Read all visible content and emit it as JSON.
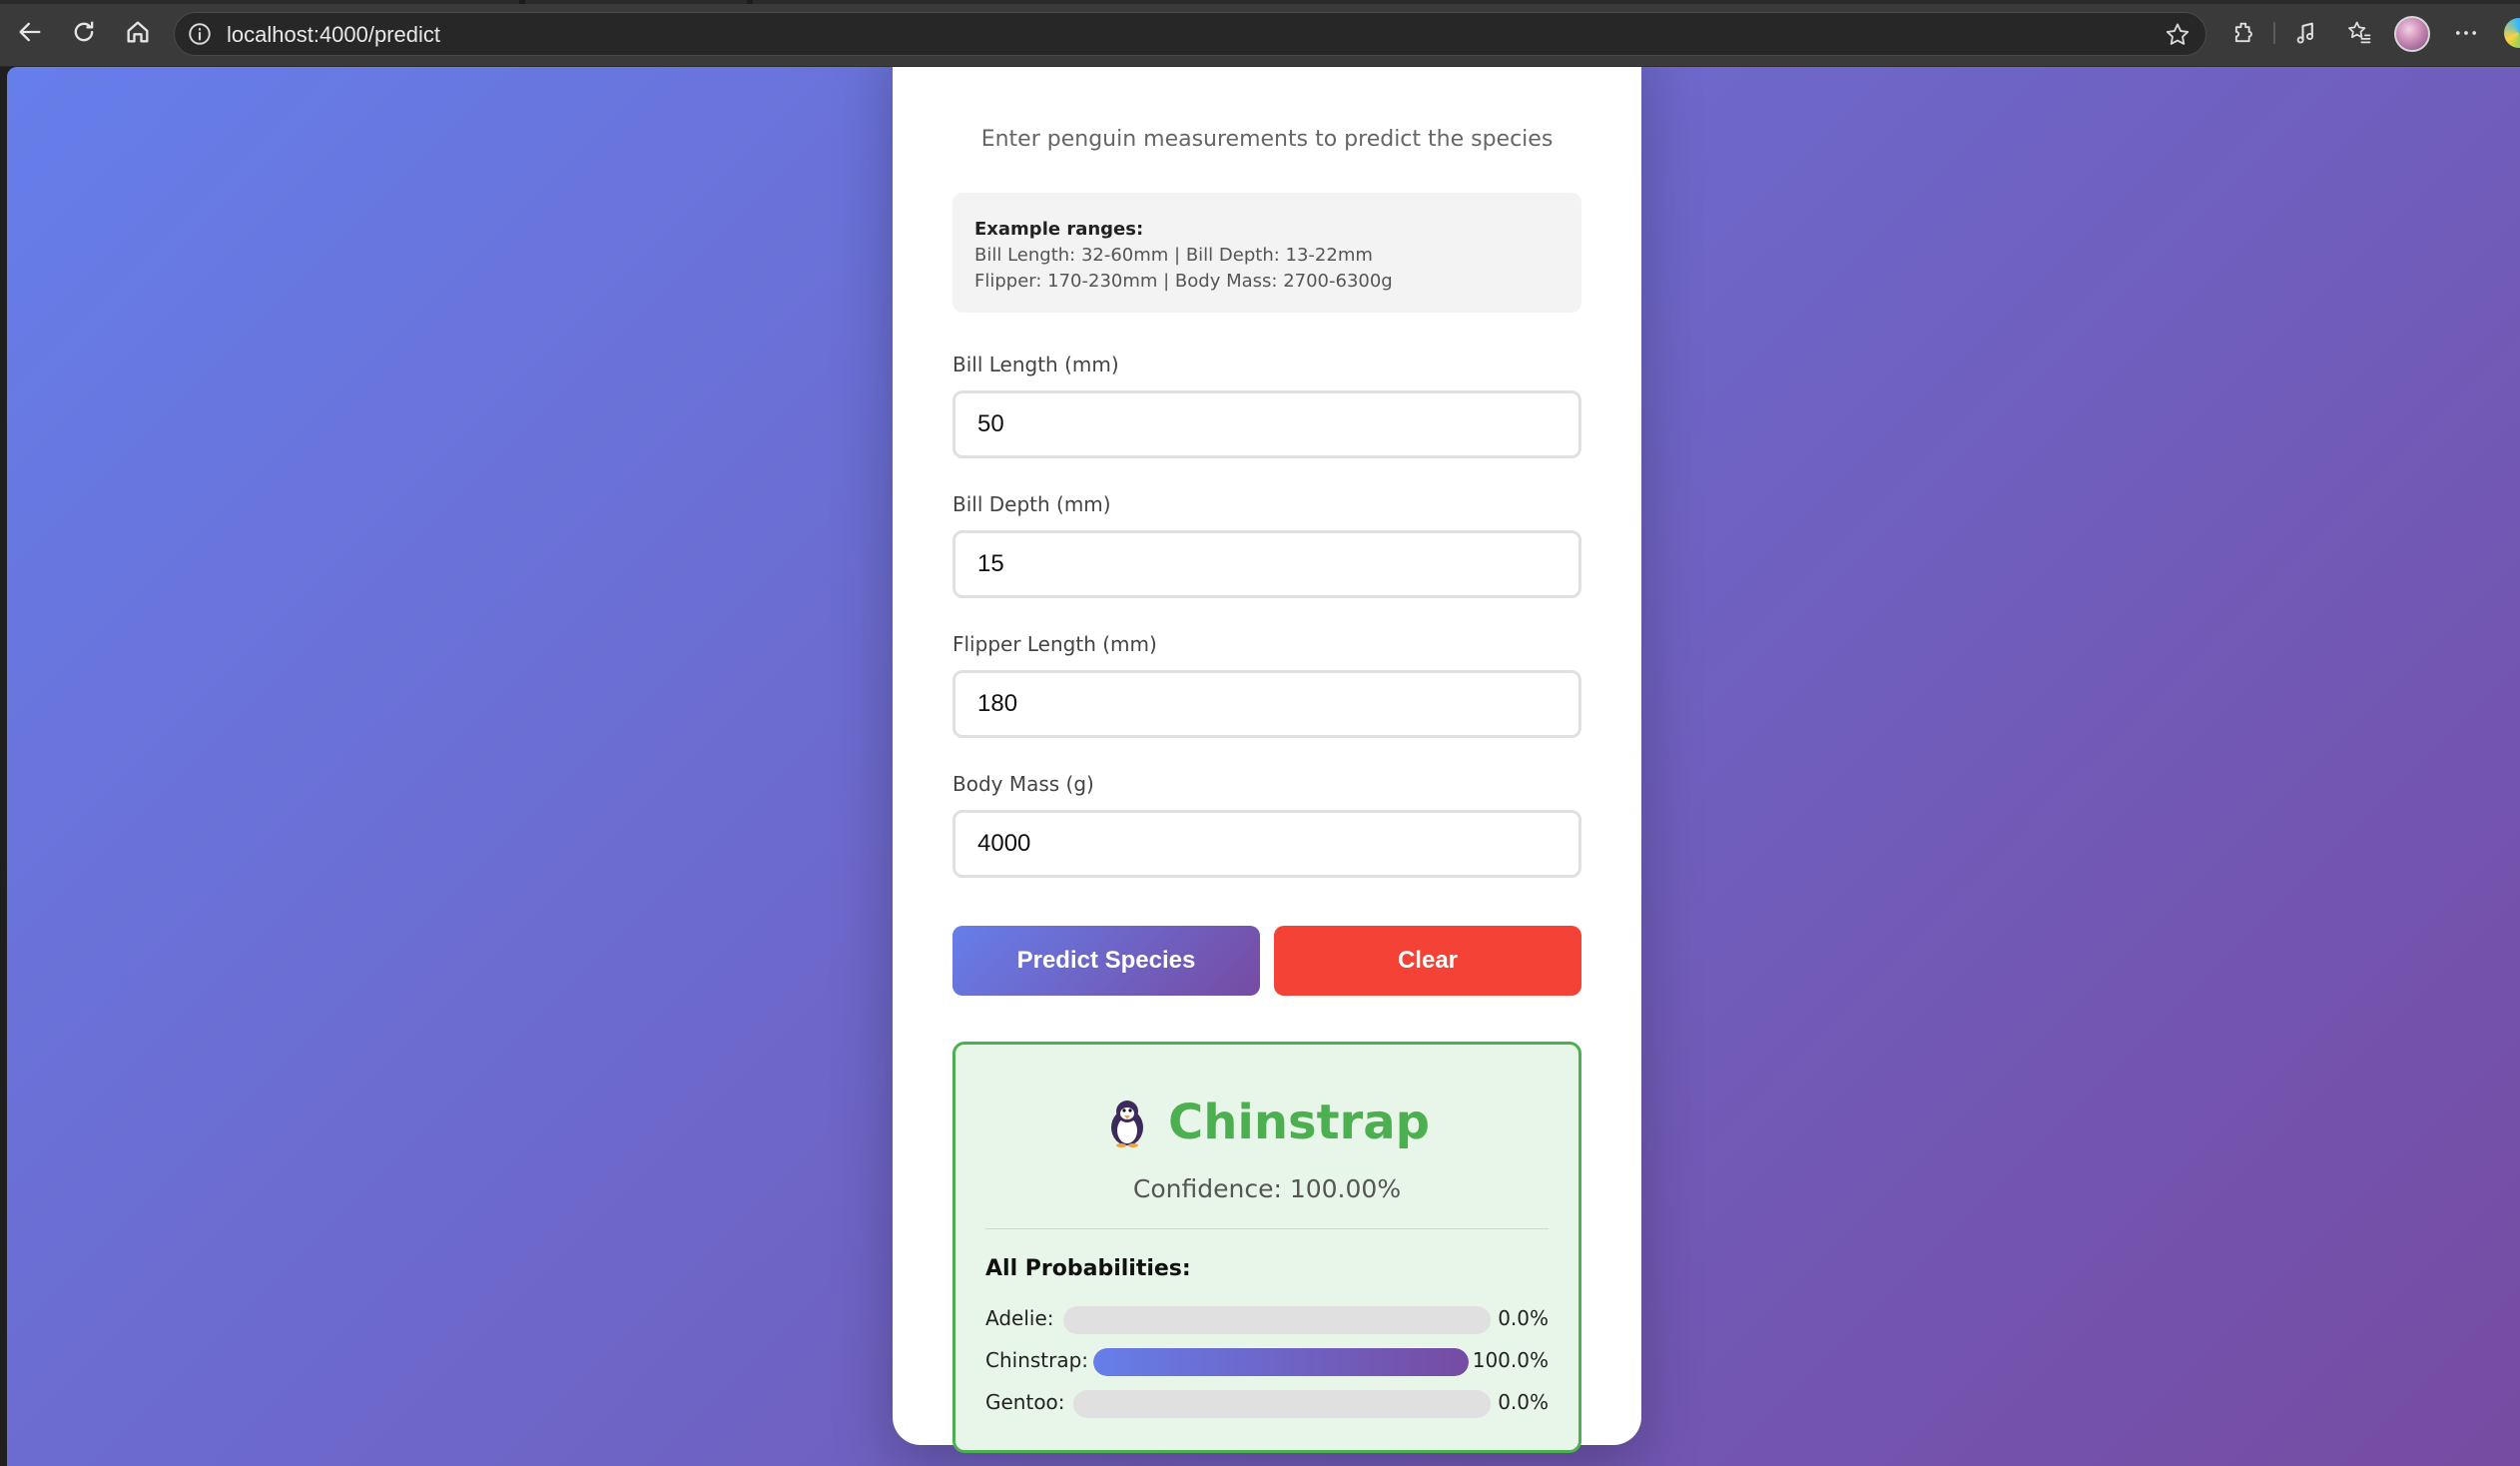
{
  "browser": {
    "url": "localhost:4000/predict"
  },
  "page": {
    "subtitle": "Enter penguin measurements to predict the species",
    "ranges": {
      "heading": "Example ranges:",
      "line1": "Bill Length: 32-60mm | Bill Depth: 13-22mm",
      "line2": "Flipper: 170-230mm | Body Mass: 2700-6300g"
    },
    "fields": {
      "bill_length": {
        "label": "Bill Length (mm)",
        "value": "50"
      },
      "bill_depth": {
        "label": "Bill Depth (mm)",
        "value": "15"
      },
      "flipper_length": {
        "label": "Flipper Length (mm)",
        "value": "180"
      },
      "body_mass": {
        "label": "Body Mass (g)",
        "value": "4000"
      }
    },
    "buttons": {
      "predict": "Predict Species",
      "clear": "Clear"
    },
    "result": {
      "icon": "penguin-icon",
      "species": "Chinstrap",
      "confidence": "Confidence: 100.00%",
      "probabilities_title": "All Probabilities:",
      "probabilities": [
        {
          "name": "Adelie:",
          "value": 0.0,
          "label": "0.0%"
        },
        {
          "name": "Chinstrap:",
          "value": 100.0,
          "label": "100.0%"
        },
        {
          "name": "Gentoo:",
          "value": 0.0,
          "label": "0.0%"
        }
      ]
    }
  },
  "colors": {
    "gradient_start": "#667eea",
    "gradient_end": "#764ba2",
    "success": "#4caf50",
    "danger": "#f44336"
  }
}
